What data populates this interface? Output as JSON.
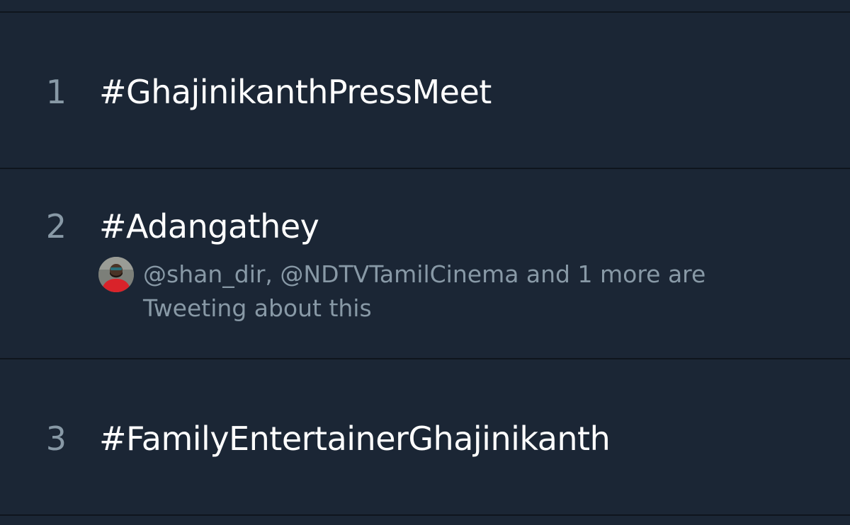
{
  "trends": [
    {
      "rank": "1",
      "hashtag": "#GhajinikanthPressMeet"
    },
    {
      "rank": "2",
      "hashtag": "#Adangathey",
      "context": "@shan_dir, @NDTVTamilCinema and 1 more are Tweeting about this",
      "avatar_icon": "user-avatar-icon"
    },
    {
      "rank": "3",
      "hashtag": "#FamilyEntertainerGhajinikanth"
    }
  ],
  "colors": {
    "background": "#1b2635",
    "divider": "#0f151d",
    "primary_text": "#ffffff",
    "secondary_text": "#8899a6"
  }
}
